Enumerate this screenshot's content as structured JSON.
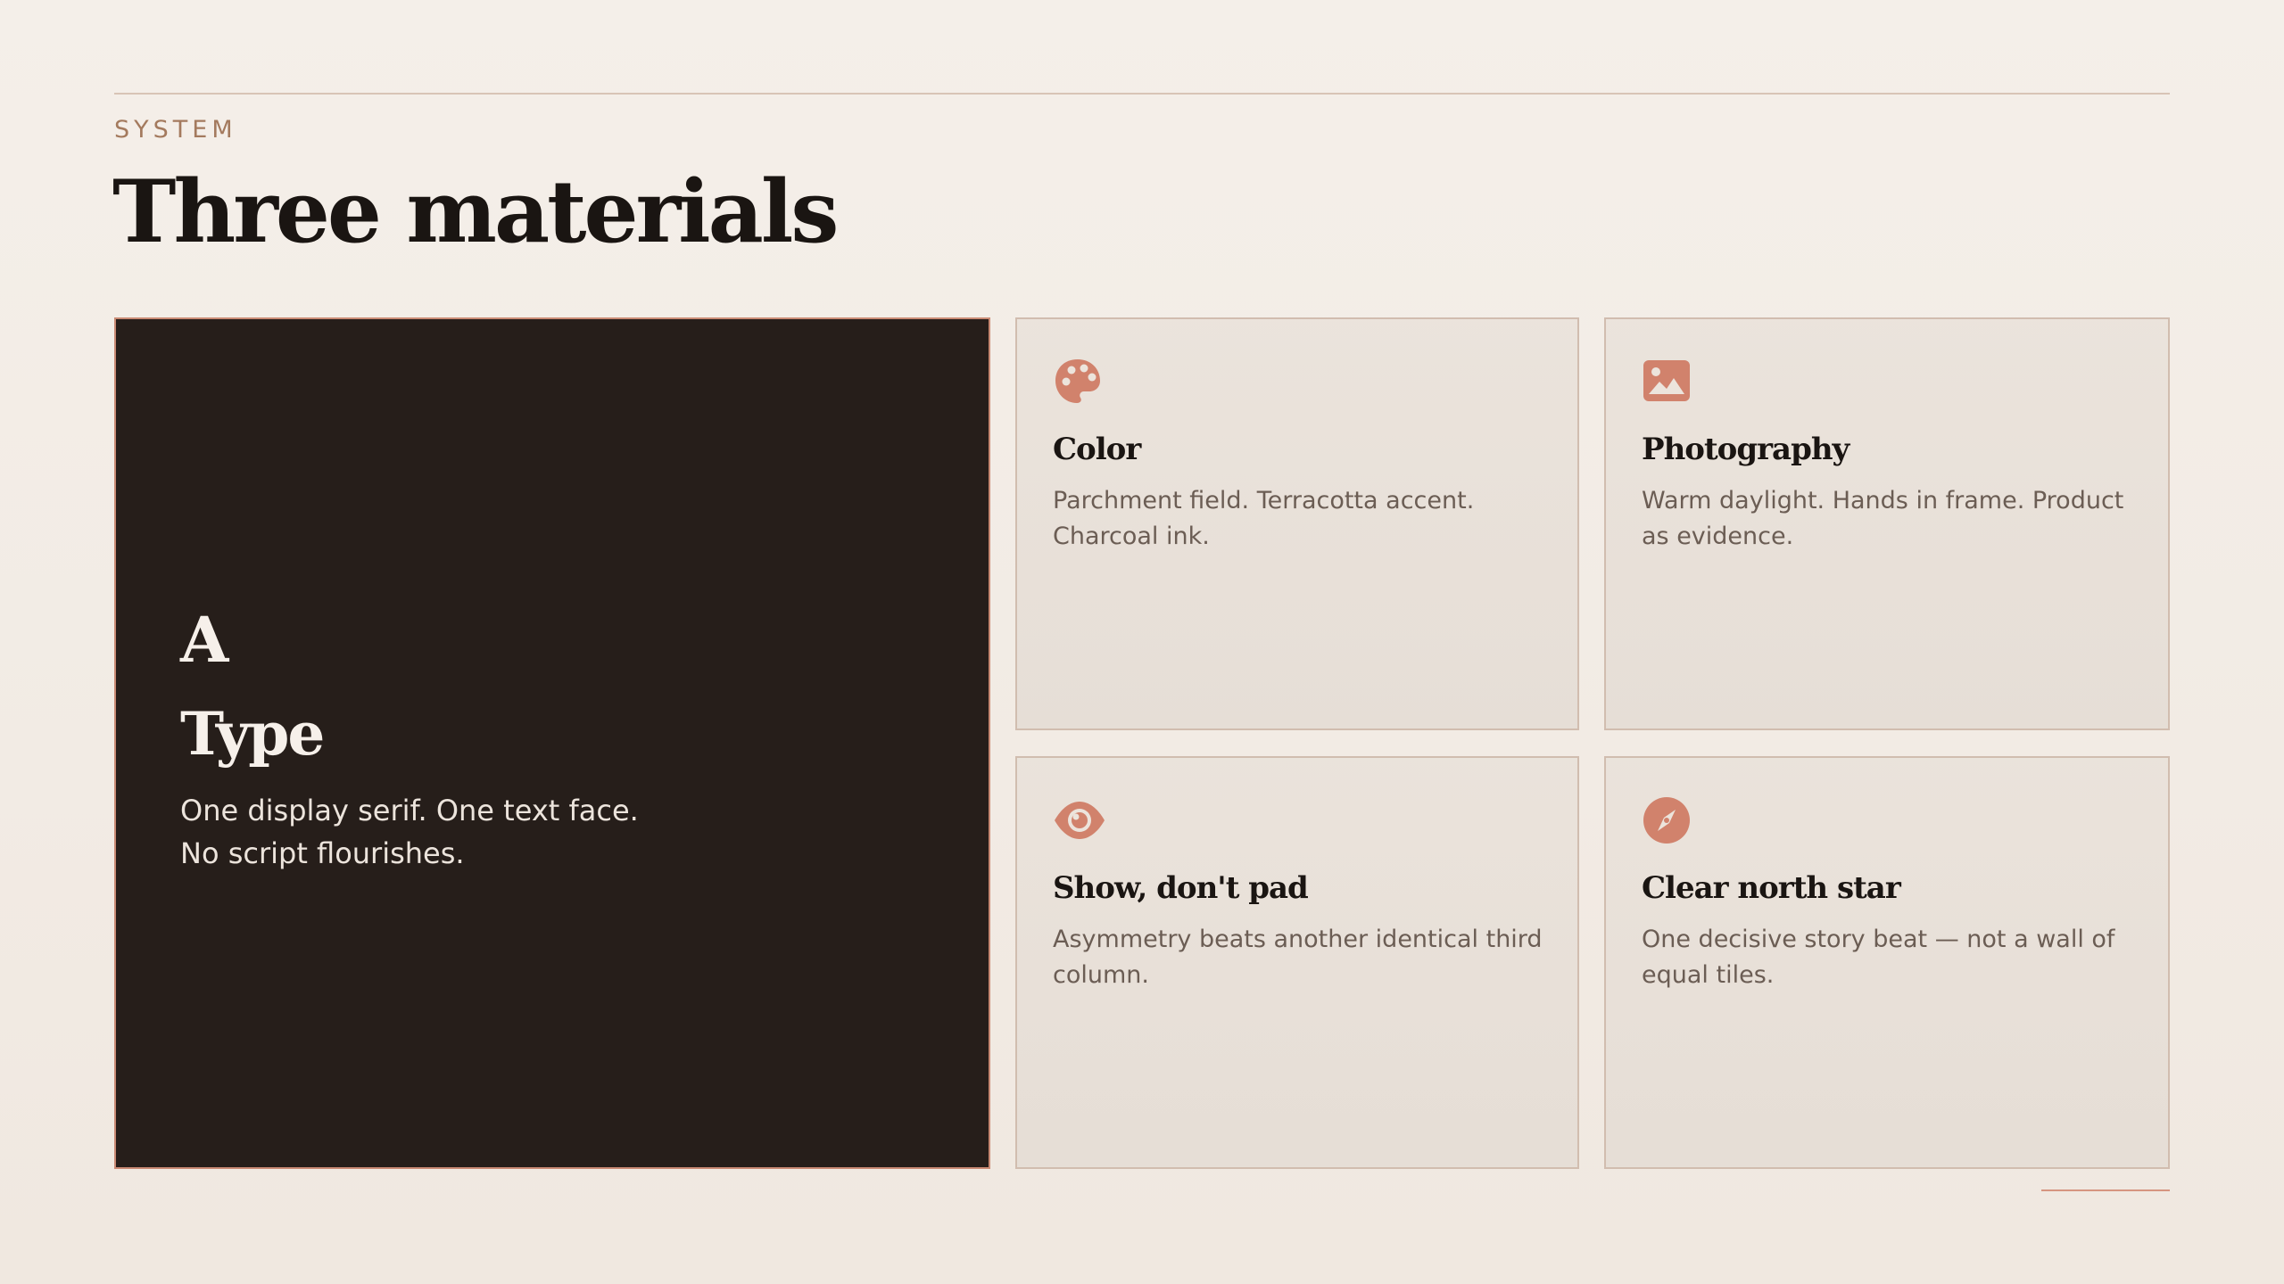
{
  "section": {
    "eyebrow": "SYSTEM",
    "title": "Three materials"
  },
  "hero": {
    "glyph": "A",
    "title": "Type",
    "text": "One display serif. One text face. No script flourishes.",
    "background": "#261e1a",
    "border_color": "#c98a74"
  },
  "tiles": [
    {
      "icon": "palette-icon",
      "title": "Color",
      "text": "Parchment field. Terracotta accent. Charcoal ink."
    },
    {
      "icon": "image-icon",
      "title": "Photography",
      "text": "Warm daylight. Hands in frame. Product as evidence."
    },
    {
      "icon": "eye-icon",
      "title": "Show, don't pad",
      "text": "Asymmetry beats another identical third column."
    },
    {
      "icon": "compass-icon",
      "title": "Clear north star",
      "text": "One decisive story beat — not a wall of equal tiles."
    }
  ],
  "colors": {
    "background": "#f3ede6",
    "accent": "#d1826c",
    "ink": "#1a1512",
    "muted_text": "#6b5d54",
    "eyebrow": "#a47a5e"
  }
}
